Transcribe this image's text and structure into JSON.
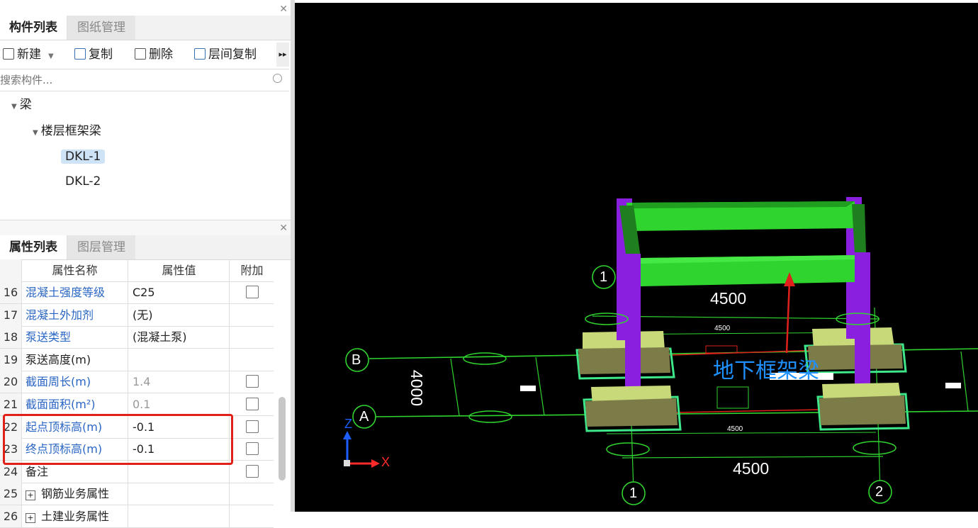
{
  "component_panel": {
    "tabs": [
      "构件列表",
      "图纸管理"
    ],
    "toolbar": {
      "new_label": "新建",
      "copy_label": "复制",
      "delete_label": "删除",
      "floor_copy_label": "层间复制"
    },
    "search": {
      "placeholder": "搜索构件..."
    },
    "tree": {
      "root": "梁",
      "group": "楼层框架梁",
      "items": [
        "DKL-1",
        "DKL-2"
      ],
      "selected": "DKL-1"
    }
  },
  "property_panel": {
    "tabs": [
      "属性列表",
      "图层管理"
    ],
    "columns": [
      "属性名称",
      "属性值",
      "附加"
    ],
    "rows": [
      {
        "num": "16",
        "name": "混凝土强度等级",
        "value": "C25",
        "checkbox": true
      },
      {
        "num": "17",
        "name": "混凝土外加剂",
        "value": "(无)",
        "checkbox": false
      },
      {
        "num": "18",
        "name": "泵送类型",
        "value": "(混凝土泵)",
        "checkbox": false
      },
      {
        "num": "19",
        "name": "泵送高度(m)",
        "value": "",
        "checkbox": false
      },
      {
        "num": "20",
        "name": "截面周长(m)",
        "value": "1.4",
        "checkbox": true
      },
      {
        "num": "21",
        "name": "截面面积(m²)",
        "value": "0.1",
        "checkbox": true
      },
      {
        "num": "22",
        "name": "起点顶标高(m)",
        "value": "-0.1",
        "checkbox": true
      },
      {
        "num": "23",
        "name": "终点顶标高(m)",
        "value": "-0.1",
        "checkbox": true
      },
      {
        "num": "24",
        "name": "备注",
        "value": "",
        "checkbox": true
      },
      {
        "num": "25",
        "name": "钢筋业务属性",
        "value": "",
        "checkbox": false
      },
      {
        "num": "26",
        "name": "土建业务属性",
        "value": "",
        "checkbox": false
      }
    ]
  },
  "viewport": {
    "axis_labels": {
      "a": "A",
      "b": "B",
      "one_top": "1",
      "one_bottom": "1",
      "two_bottom": "2"
    },
    "dimensions": {
      "top_span": "4500",
      "bottom_span": "4500",
      "vertical_span": "4000",
      "small_top": "4500",
      "small_bottom": "4500"
    },
    "annotation": "地下框架梁",
    "gizmo": {
      "x": "X",
      "z": "Z"
    }
  },
  "colors": {
    "beam": "#2fd42f",
    "column": "#8b1fe0",
    "footing": "#c8d97a",
    "grid_line": "#2fd42f",
    "annotation": "#1e90ff",
    "highlight": "#e0201a"
  }
}
